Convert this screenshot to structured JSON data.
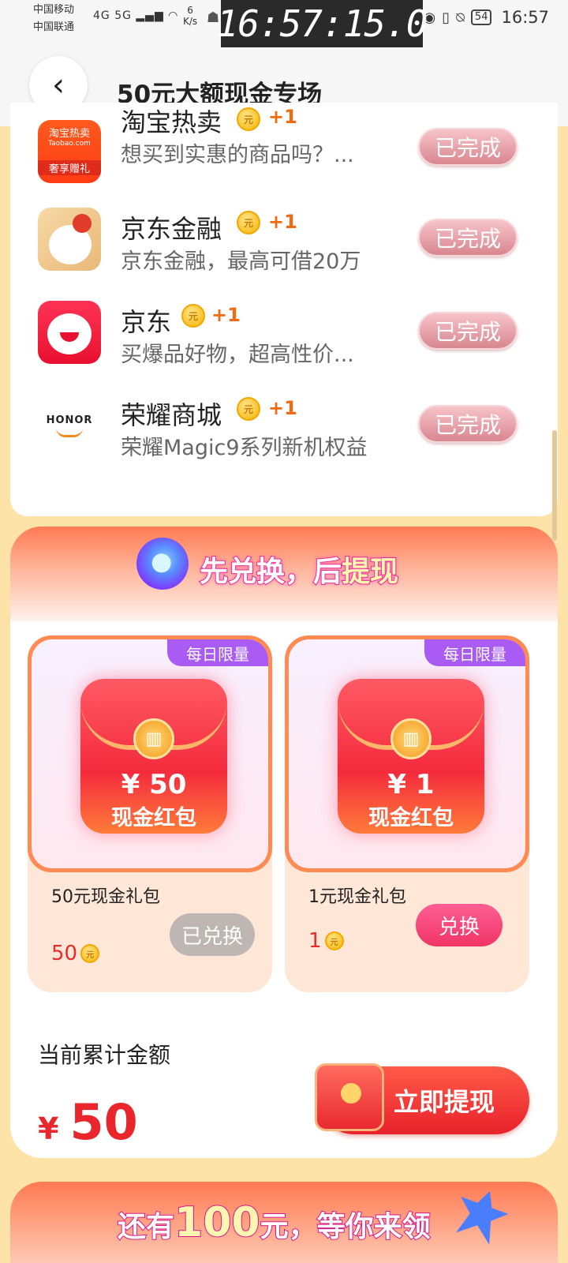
{
  "status_bar": {
    "carrier1": "中国移动",
    "carrier2": "中国联通",
    "signal_text": "4G  5G",
    "speed_value": "6",
    "speed_unit": "K/s",
    "battery": "54",
    "time": "16:57"
  },
  "timestamp_overlay": "16:57:15.0",
  "header": {
    "title": "50元大额现金专场"
  },
  "tasks": [
    {
      "name": "淘宝热卖",
      "reward": "+1",
      "desc": "想买到实惠的商品吗？...",
      "status": "已完成",
      "icon": "taobao-icon"
    },
    {
      "name": "京东金融",
      "reward": "+1",
      "desc": "京东金融，最高可借20万",
      "status": "已完成",
      "icon": "jd-finance-icon"
    },
    {
      "name": "京东",
      "reward": "+1",
      "desc": "买爆品好物，超高性价...",
      "status": "已完成",
      "icon": "jd-icon"
    },
    {
      "name": "荣耀商城",
      "reward": "+1",
      "desc": "荣耀Magic9系列新机权益",
      "status": "已完成",
      "icon": "honor-icon"
    }
  ],
  "task_icon_text": {
    "taobao_top": "淘宝热卖",
    "taobao_mid": "Taobao.com",
    "taobao_bottom": "奢享赠礼",
    "honor": "HONOR"
  },
  "coin_glyph": "元",
  "exchange": {
    "title_part1": "先兑换，后",
    "title_part2": "提现",
    "prizes": [
      {
        "tag": "每日限量",
        "amount": "¥ 50",
        "packet_label": "现金红包",
        "name": "50元现金礼包",
        "price": "50",
        "button": "已兑换",
        "state": "exchanged"
      },
      {
        "tag": "每日限量",
        "amount": "¥ 1",
        "packet_label": "现金红包",
        "name": "1元现金礼包",
        "price": "1",
        "button": "兑换",
        "state": "available"
      }
    ],
    "total_label": "当前累计金额",
    "total_currency": "¥",
    "total_value": "50",
    "withdraw_button": "立即提现"
  },
  "more": {
    "prefix": "还有",
    "amount": "100",
    "suffix": "元，等你来领"
  },
  "colors": {
    "page_bg": "#fde3a8",
    "accent_red": "#e8262c",
    "done_button": "#d9868f",
    "limit_tag": "#a95bf3"
  }
}
